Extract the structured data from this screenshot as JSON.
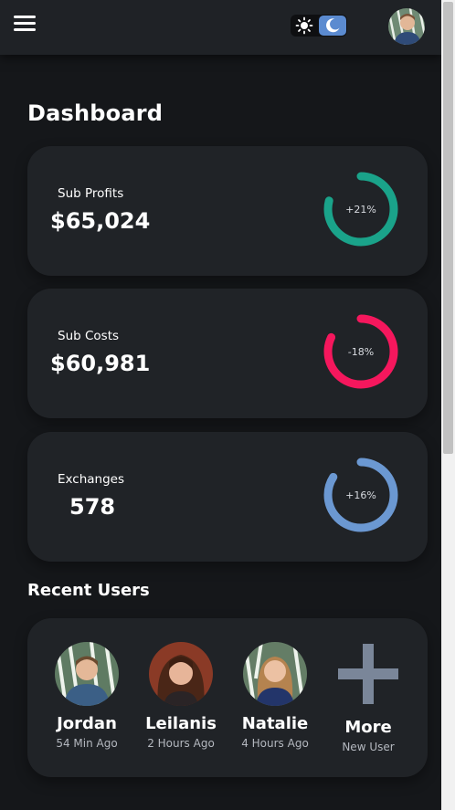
{
  "header": {
    "menu_icon": "hamburger-menu-icon",
    "theme_toggle": {
      "light_icon": "sun-icon",
      "dark_icon": "moon-icon",
      "active": "dark"
    },
    "avatar": "profile-avatar"
  },
  "page": {
    "title": "Dashboard"
  },
  "stats": [
    {
      "label": "Sub Profits",
      "value": "$65,024",
      "change": "+21%",
      "percent": 0.79,
      "color": "#1aa38a"
    },
    {
      "label": "Sub Costs",
      "value": "$60,981",
      "change": "-18%",
      "percent": 0.82,
      "color": "#f5175d"
    },
    {
      "label": "Exchanges",
      "value": "578",
      "change": "+16%",
      "percent": 0.84,
      "color": "#6b98d2"
    }
  ],
  "recent_users": {
    "title": "Recent Users",
    "users": [
      {
        "name": "Jordan",
        "time": "54 Min Ago"
      },
      {
        "name": "Leilanis",
        "time": "2 Hours Ago"
      },
      {
        "name": "Natalie",
        "time": "4 Hours Ago"
      }
    ],
    "more": {
      "label": "More",
      "sub": "New User",
      "icon": "plus-icon"
    }
  }
}
